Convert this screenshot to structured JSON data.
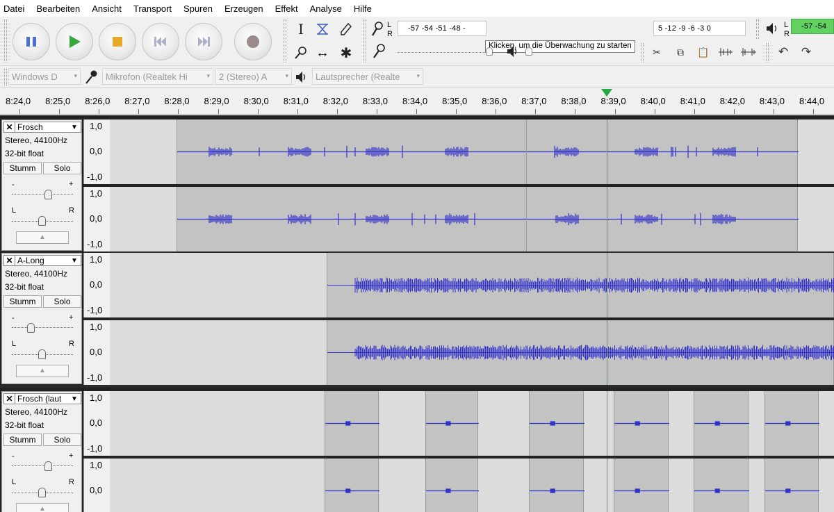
{
  "menu": [
    "Datei",
    "Bearbeiten",
    "Ansicht",
    "Transport",
    "Spuren",
    "Erzeugen",
    "Effekt",
    "Analyse",
    "Hilfe"
  ],
  "transport": {
    "pause": "pause-icon",
    "play": "play-icon",
    "stop": "stop-icon",
    "skip_start": "skip-start-icon",
    "skip_end": "skip-end-icon",
    "record": "record-icon"
  },
  "tools": {
    "select": "I",
    "zoom": "⌕",
    "timeshift": "↔",
    "draw": "✎",
    "multi": "✱",
    "envelope": "≍"
  },
  "meters": {
    "record_scale": "-57 -54 -51 -48 -",
    "record_scale_right": "5 -12 -9 -6 -3 0",
    "play_scale": "-57 -54",
    "record_meter_L": "L",
    "record_meter_R": "R",
    "play_meter_L": "L",
    "play_meter_R": "R",
    "tooltip": "Klicken, um die Überwachung zu starten"
  },
  "devices": {
    "host": "Windows D",
    "mic": "Mikrofon (Realtek Hi",
    "channels": "2 (Stereo) A",
    "speaker": "Lautsprecher (Realte"
  },
  "ruler": [
    "8:24,0",
    "8:25,0",
    "8:26,0",
    "8:27,0",
    "8:28,0",
    "8:29,0",
    "8:30,0",
    "8:31,0",
    "8:32,0",
    "8:33,0",
    "8:34,0",
    "8:35,0",
    "8:36,0",
    "8:37,0",
    "8:38,0",
    "8:39,0",
    "8:40,0",
    "8:41,0",
    "8:42,0",
    "8:43,0",
    "8:44,0"
  ],
  "tracks": [
    {
      "name": "Frosch",
      "info1": "Stereo, 44100Hz",
      "info2": "32-bit float",
      "mute": "Stumm",
      "solo": "Solo",
      "gain_label": "+",
      "gain_minus": "-",
      "pan_left": "L",
      "pan_right": "R"
    },
    {
      "name": "A-Long",
      "info1": "Stereo, 44100Hz",
      "info2": "32-bit float",
      "mute": "Stumm",
      "solo": "Solo",
      "gain_label": "+",
      "gain_minus": "-",
      "pan_left": "L",
      "pan_right": "R"
    },
    {
      "name": "Frosch (laut",
      "info1": "Stereo, 44100Hz",
      "info2": "32-bit float",
      "mute": "Stumm",
      "solo": "Solo",
      "gain_label": "+",
      "gain_minus": "-",
      "pan_left": "L",
      "pan_right": "R"
    }
  ],
  "scale": {
    "top": "1,0",
    "mid": "0,0",
    "bot": "-1,0"
  },
  "colors": {
    "wave": "#3232c8",
    "clip": "#c3c3c3",
    "background": "#dcdcdc",
    "meter_green": "#5ac85a"
  }
}
